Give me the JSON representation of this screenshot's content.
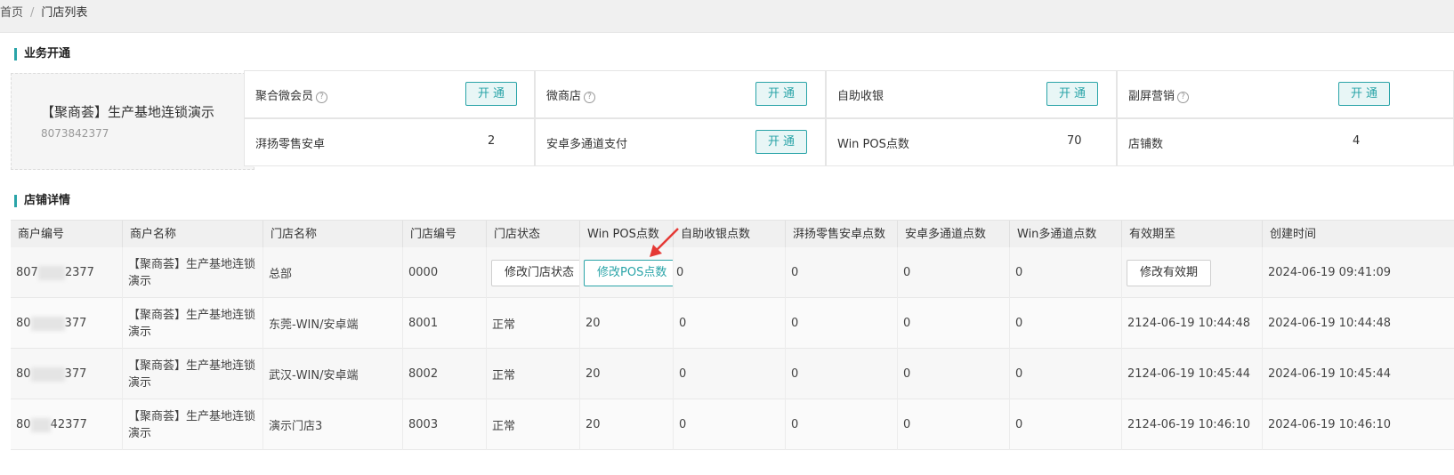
{
  "breadcrumb": {
    "home": "首页",
    "separator": "/",
    "current": "门店列表"
  },
  "business": {
    "title": "业务开通",
    "merchant_name": "【聚商荟】生产基地连锁演示",
    "merchant_id": "8073842377",
    "open_label": "开通",
    "cells": [
      {
        "label": "聚合微会员",
        "help": "?"
      },
      {
        "label": "微商店",
        "help": "?"
      },
      {
        "label": "自助收银"
      },
      {
        "label": "副屏营销",
        "help": "?"
      },
      {
        "label": "湃扬零售安卓",
        "value": "2"
      },
      {
        "label": "安卓多通道支付"
      },
      {
        "label": "Win POS点数",
        "value": "70"
      },
      {
        "label": "店铺数",
        "value": "4"
      }
    ]
  },
  "store_details": {
    "title": "店铺详情",
    "columns": [
      "商户编号",
      "商户名称",
      "门店名称",
      "门店编号",
      "门店状态",
      "Win POS点数",
      "自助收银点数",
      "湃扬零售安卓点数",
      "安卓多通道点数",
      "Win多通道点数",
      "有效期至",
      "创建时间"
    ],
    "rows": [
      {
        "merchant_id_prefix": "807",
        "merchant_id_suffix": "2377",
        "merchant_name": "【聚商荟】生产基地连锁演示",
        "store_name": "总部",
        "store_no": "0000",
        "status_button": "修改门店状态",
        "pos_button": "修改POS点数",
        "self_checkout": "0",
        "payang": "0",
        "android_multi": "0",
        "win_multi": "0",
        "expiry_button": "修改有效期",
        "created": "2024-06-19 09:41:09"
      },
      {
        "merchant_id_prefix": "80",
        "merchant_id_suffix": "377",
        "merchant_name": "【聚商荟】生产基地连锁演示",
        "store_name": "东莞-WIN/安卓端",
        "store_no": "8001",
        "status": "正常",
        "pos": "20",
        "self_checkout": "0",
        "payang": "0",
        "android_multi": "0",
        "win_multi": "0",
        "expiry": "2124-06-19 10:44:48",
        "created": "2024-06-19 10:44:48"
      },
      {
        "merchant_id_prefix": "80",
        "merchant_id_suffix": "377",
        "merchant_name": "【聚商荟】生产基地连锁演示",
        "store_name": "武汉-WIN/安卓端",
        "store_no": "8002",
        "status": "正常",
        "pos": "20",
        "self_checkout": "0",
        "payang": "0",
        "android_multi": "0",
        "win_multi": "0",
        "expiry": "2124-06-19 10:45:44",
        "created": "2024-06-19 10:45:44"
      },
      {
        "merchant_id_prefix": "80",
        "merchant_id_suffix": "42377",
        "merchant_name": "【聚商荟】生产基地连锁演示",
        "store_name": "演示门店3",
        "store_no": "8003",
        "status": "正常",
        "pos": "20",
        "self_checkout": "0",
        "payang": "0",
        "android_multi": "0",
        "win_multi": "0",
        "expiry": "2124-06-19 10:46:10",
        "created": "2024-06-19 10:46:10"
      }
    ]
  },
  "colors": {
    "accent": "#2aa4a8",
    "arrow": "#e53935"
  }
}
